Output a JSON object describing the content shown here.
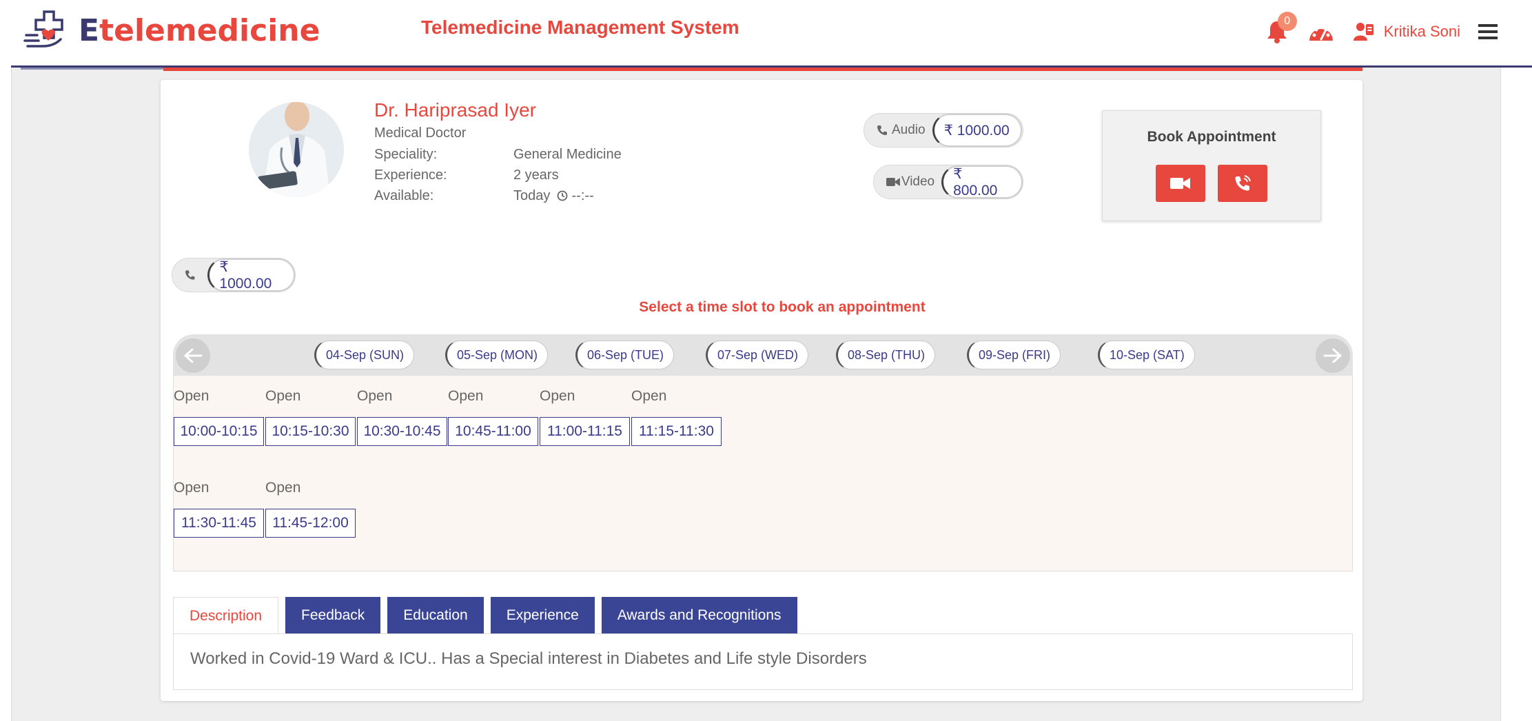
{
  "header": {
    "logo_text_e": "E",
    "logo_text_rest": "telemedicine",
    "system_title": "Telemedicine Management System",
    "notification_count": "0",
    "user_name": "Kritika Soni"
  },
  "doctor": {
    "name": "Dr. Hariprasad Iyer",
    "title": "Medical Doctor",
    "info": [
      {
        "key": "Speciality:",
        "value": "General Medicine"
      },
      {
        "key": "Experience:",
        "value": "2 years"
      },
      {
        "key": "Available:",
        "value": "Today",
        "time": "--:--"
      }
    ]
  },
  "fees": {
    "audio_label": "Audio",
    "audio_amount": "₹ 1000.00",
    "video_label": "Video",
    "video_amount": "₹ 800.00",
    "phone_amount": "₹ 1000.00"
  },
  "booking": {
    "title": "Book Appointment",
    "select_message": "Select a time slot to book an appointment"
  },
  "dates": [
    "04-Sep (SUN)",
    "05-Sep (MON)",
    "06-Sep (TUE)",
    "07-Sep (WED)",
    "08-Sep (THU)",
    "09-Sep (FRI)",
    "10-Sep (SAT)"
  ],
  "slots": [
    {
      "status": "Open",
      "time": "10:00-10:15"
    },
    {
      "status": "Open",
      "time": "10:15-10:30"
    },
    {
      "status": "Open",
      "time": "10:30-10:45"
    },
    {
      "status": "Open",
      "time": "10:45-11:00"
    },
    {
      "status": "Open",
      "time": "11:00-11:15"
    },
    {
      "status": "Open",
      "time": "11:15-11:30"
    },
    {
      "status": "Open",
      "time": "11:30-11:45"
    },
    {
      "status": "Open",
      "time": "11:45-12:00"
    }
  ],
  "tabs": [
    "Description",
    "Feedback",
    "Education",
    "Experience",
    "Awards and Recognitions"
  ],
  "description_text": "Worked in Covid-19 Ward & ICU.. Has a Special interest in Diabetes and Life style Disorders",
  "colors": {
    "accent": "#e8473d",
    "navy": "#3b4596",
    "slot_border": "#3a3a8a"
  },
  "icons": [
    "logo-hand-heart-icon",
    "bell-icon",
    "dashboard-gauge-icon",
    "user-card-icon",
    "menu-icon",
    "phone-icon",
    "video-camera-icon",
    "clock-icon",
    "arrow-left-icon",
    "arrow-right-icon",
    "phone-volume-icon"
  ]
}
